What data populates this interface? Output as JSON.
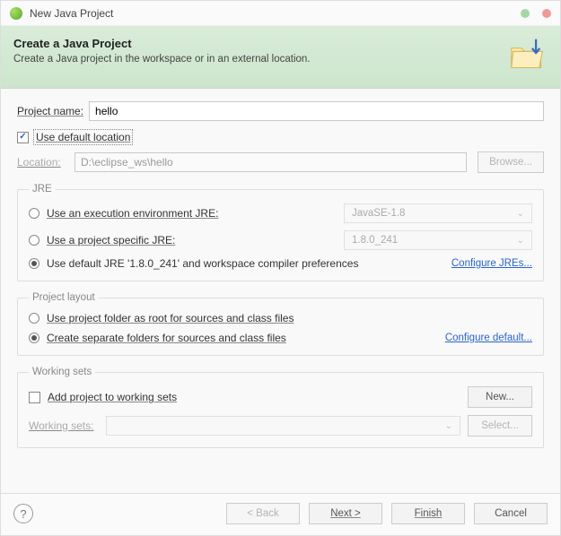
{
  "window": {
    "title": "New Java Project"
  },
  "banner": {
    "title": "Create a Java Project",
    "description": "Create a Java project in the workspace or in an external location."
  },
  "project": {
    "name_label": "Project name:",
    "name_value": "hello",
    "use_default_location_label": "Use default location",
    "location_label": "Location:",
    "location_value": "D:\\eclipse_ws\\hello",
    "browse_label": "Browse..."
  },
  "jre": {
    "legend": "JRE",
    "exec_env_label": "Use an execution environment JRE:",
    "exec_env_value": "JavaSE-1.8",
    "project_specific_label": "Use a project specific JRE:",
    "project_specific_value": "1.8.0_241",
    "default_jre_label": "Use default JRE '1.8.0_241' and workspace compiler preferences",
    "configure_link": "Configure JREs..."
  },
  "layout": {
    "legend": "Project layout",
    "root_label": "Use project folder as root for sources and class files",
    "separate_label": "Create separate folders for sources and class files",
    "configure_link": "Configure default..."
  },
  "working_sets": {
    "legend": "Working sets",
    "add_label": "Add project to working sets",
    "new_label": "New...",
    "select_label": "Select...",
    "ws_label": "Working sets:"
  },
  "footer": {
    "back": "< Back",
    "next": "Next >",
    "finish": "Finish",
    "cancel": "Cancel"
  }
}
